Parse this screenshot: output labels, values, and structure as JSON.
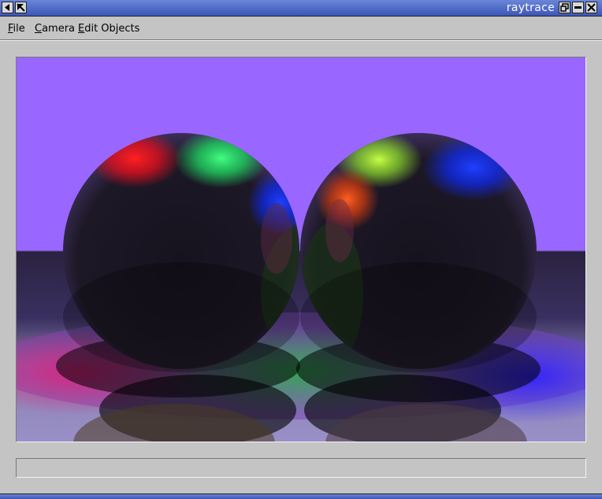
{
  "window": {
    "title": "raytrace"
  },
  "titlebar_icons": [
    "left-arrow-icon",
    "resize-corner-icon",
    "restore-icon",
    "minimize-icon",
    "close-icon"
  ],
  "menubar": {
    "items": [
      {
        "label": "File",
        "mnemonic": "F",
        "rest": "ile"
      },
      {
        "label": "Camera",
        "mnemonic": "C",
        "rest": "amera"
      },
      {
        "label": "Edit Objects",
        "mnemonic": "E",
        "rest": "dit Objects"
      }
    ]
  },
  "scene": {
    "sky_color": "#9966ff",
    "floor_color": "#2f2750",
    "sphere_count": 2
  },
  "status": {
    "text": ""
  },
  "colors": {
    "titlebar": "#4a66c8",
    "window_bg": "#c4c4c4"
  }
}
